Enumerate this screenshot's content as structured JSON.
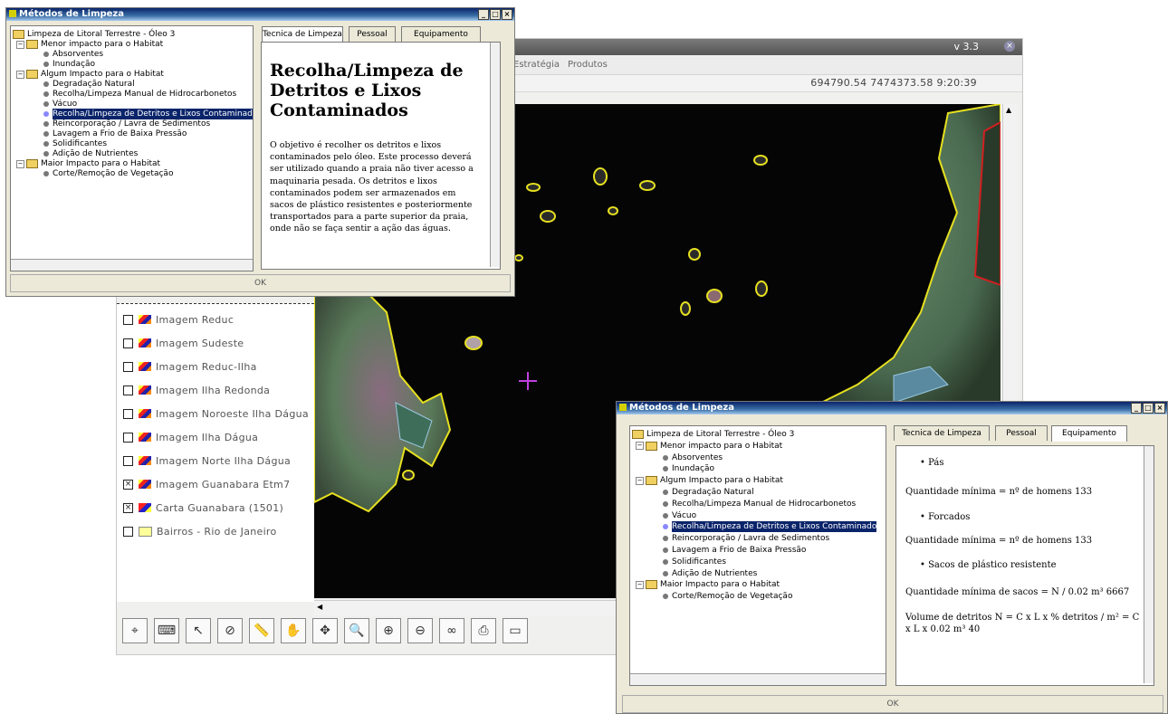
{
  "main_window": {
    "version": "v 3.3",
    "menu": [
      "Estratégia",
      "Produtos"
    ],
    "coordinates": "694790.54  7474373.58   9:20:39"
  },
  "layers": [
    {
      "label": "Imagem Reduc",
      "checked": false,
      "icon": "image-layer-icon"
    },
    {
      "label": "Imagem Sudeste",
      "checked": false,
      "icon": "image-layer-icon"
    },
    {
      "label": "Imagem Reduc-Ilha",
      "checked": false,
      "icon": "image-layer-icon"
    },
    {
      "label": "Imagem Ilha Redonda",
      "checked": false,
      "icon": "image-layer-icon"
    },
    {
      "label": "Imagem Noroeste Ilha Dágua",
      "checked": false,
      "icon": "image-layer-icon"
    },
    {
      "label": "Imagem Ilha Dágua",
      "checked": false,
      "icon": "image-layer-icon"
    },
    {
      "label": "Imagem Norte Ilha Dágua",
      "checked": false,
      "icon": "image-layer-icon"
    },
    {
      "label": "Imagem Guanabara Etm7",
      "checked": true,
      "icon": "image-layer-icon"
    },
    {
      "label": "Carta Guanabara (1501)",
      "checked": true,
      "icon": "map-layer-icon"
    },
    {
      "label": "Bairros - Rio de Janeiro",
      "checked": false,
      "icon": "polygon-layer-icon"
    }
  ],
  "dialog": {
    "title": "Métodos de Limpeza",
    "tree": {
      "root": "Limpeza de Litoral Terrestre - Óleo 3",
      "groups": [
        {
          "label": "Menor impacto para o Habitat",
          "items": [
            "Absorventes",
            "Inundação"
          ]
        },
        {
          "label": "Algum Impacto para o Habitat",
          "items": [
            "Degradação Natural",
            "Recolha/Limpeza Manual de Hidrocarbonetos",
            "Vácuo",
            "Recolha/Limpeza de Detritos e Lixos Contaminados",
            "Reincorporação / Lavra de Sedimentos",
            "Lavagem a Frio de Baixa Pressão",
            "Solidificantes",
            "Adição de Nutrientes"
          ]
        },
        {
          "label": "Maior Impacto para o Habitat",
          "items": [
            "Corte/Remoção de Vegetação"
          ]
        }
      ],
      "selected": "Recolha/Limpeza de Detritos e Lixos Contaminados",
      "selected_truncated_1": "Recolha/Limpeza de Detritos e Lixos Contaminados",
      "selected_truncated_2": "Recolha/Limpeza de Detritos e Lixos Contaminado"
    },
    "tabs": [
      "Tecnica de Limpeza",
      "Pessoal",
      "Equipamento"
    ],
    "ok_label": "OK"
  },
  "dialog1": {
    "active_tab": "Tecnica de Limpeza",
    "heading": "Recolha/Limpeza de Detritos e Lixos Contaminados",
    "body": "O objetivo é recolher os detritos e lixos contaminados pelo óleo. Este processo deverá ser utilizado quando a praia não tiver acesso a maquinaria pesada. Os detritos e lixos contaminados podem ser armazenados em sacos de plástico resistentes e posteriormente transportados para a parte superior da praia, onde não se faça sentir a ação das águas."
  },
  "dialog2": {
    "active_tab": "Equipamento",
    "content": [
      {
        "type": "bullet",
        "text": "Pás"
      },
      {
        "type": "line",
        "text": "Quantidade mínima = nº de homens 133"
      },
      {
        "type": "bullet",
        "text": "Forcados"
      },
      {
        "type": "line",
        "text": "Quantidade mínima = nº de homens 133"
      },
      {
        "type": "bullet",
        "text": "Sacos de plástico resistente"
      },
      {
        "type": "line",
        "text": "Quantidade mínima de sacos = N / 0.02 m³ 6667"
      },
      {
        "type": "line",
        "text": "Volume de detritos N = C x L x % detritos / m² = C x L x 0.02 m³ 40"
      }
    ]
  },
  "toolbar": [
    "crosshair-icon",
    "keyboard-icon",
    "pointer-icon",
    "no-entry-icon",
    "ruler-icon",
    "hand-icon",
    "pan-arrows-icon",
    "zoom-icon",
    "zoom-in-icon",
    "zoom-out-icon",
    "binoculars-icon",
    "printer-icon",
    "camera-icon"
  ]
}
